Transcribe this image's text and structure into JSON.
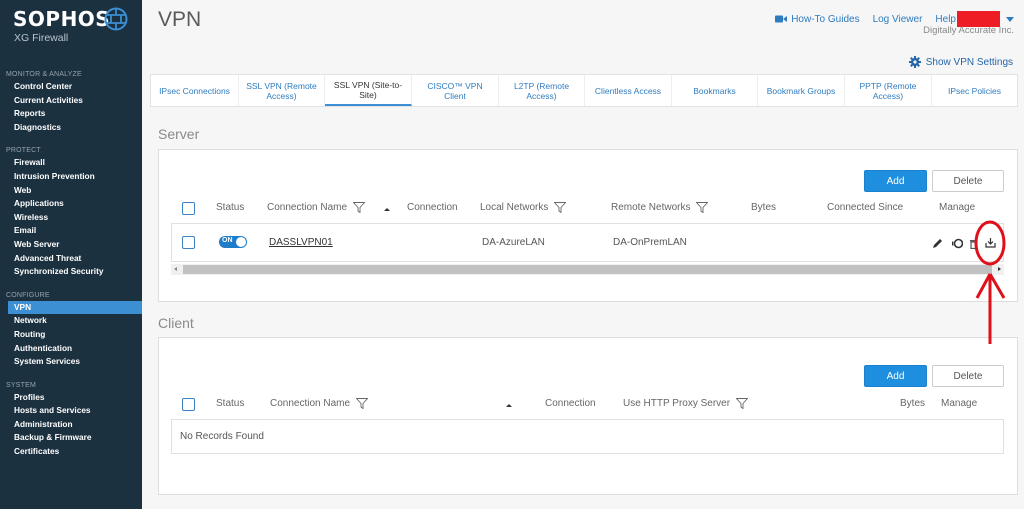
{
  "brand": {
    "name": "SOPHOS",
    "product": "XG Firewall",
    "logo_icon": "globe-brick-icon"
  },
  "sidebar": {
    "sections": [
      {
        "title": "MONITOR & ANALYZE",
        "items": [
          "Control Center",
          "Current Activities",
          "Reports",
          "Diagnostics"
        ]
      },
      {
        "title": "PROTECT",
        "items": [
          "Firewall",
          "Intrusion Prevention",
          "Web",
          "Applications",
          "Wireless",
          "Email",
          "Web Server",
          "Advanced Threat",
          "Synchronized Security"
        ]
      },
      {
        "title": "CONFIGURE",
        "items": [
          "VPN",
          "Network",
          "Routing",
          "Authentication",
          "System Services"
        ]
      },
      {
        "title": "SYSTEM",
        "items": [
          "Profiles",
          "Hosts and Services",
          "Administration",
          "Backup & Firmware",
          "Certificates"
        ]
      }
    ],
    "active_item": "VPN",
    "active_color": "#3b8fd2",
    "background": "#1c3140"
  },
  "header": {
    "title": "VPN",
    "links": {
      "how_to": "How-To Guides",
      "log_viewer": "Log Viewer",
      "help": "Help"
    },
    "how_to_icon": "video-camera-icon",
    "organization": "Digitally Accurate Inc.",
    "show_settings": "Show VPN Settings",
    "settings_icon": "gear-icon"
  },
  "tabs": [
    {
      "label": "IPsec Connections",
      "active": false
    },
    {
      "label": "SSL VPN (Remote Access)",
      "active": false
    },
    {
      "label": "SSL VPN (Site-to-Site)",
      "active": true
    },
    {
      "label": "CISCO™ VPN Client",
      "active": false
    },
    {
      "label": "L2TP (Remote Access)",
      "active": false
    },
    {
      "label": "Clientless Access",
      "active": false
    },
    {
      "label": "Bookmarks",
      "active": false
    },
    {
      "label": "Bookmark Groups",
      "active": false
    },
    {
      "label": "PPTP (Remote Access)",
      "active": false
    },
    {
      "label": "IPsec Policies",
      "active": false
    }
  ],
  "server": {
    "title": "Server",
    "add_label": "Add",
    "delete_label": "Delete",
    "columns": [
      "Status",
      "Connection Name",
      "Connection",
      "Local Networks",
      "Remote Networks",
      "Bytes",
      "Connected Since",
      "Manage"
    ],
    "rows": [
      {
        "status": "ON",
        "connection_name": "DASSLVPN01",
        "connection": "",
        "local_networks": "DA-AzureLAN",
        "remote_networks": "DA-OnPremLAN",
        "bytes": "",
        "connected_since": "",
        "manage_icons": [
          "edit-pencil-icon",
          "add-circle-icon",
          "delete-trash-icon",
          "download-icon"
        ]
      }
    ]
  },
  "client": {
    "title": "Client",
    "add_label": "Add",
    "delete_label": "Delete",
    "columns": [
      "Status",
      "Connection Name",
      "Connection",
      "Use HTTP Proxy Server",
      "Bytes",
      "Manage"
    ],
    "empty_message": "No Records Found"
  },
  "colors": {
    "accent": "#1e8fde",
    "link": "#2e7cc0",
    "annotation": "#e0101b",
    "redaction": "#ee1c25"
  }
}
